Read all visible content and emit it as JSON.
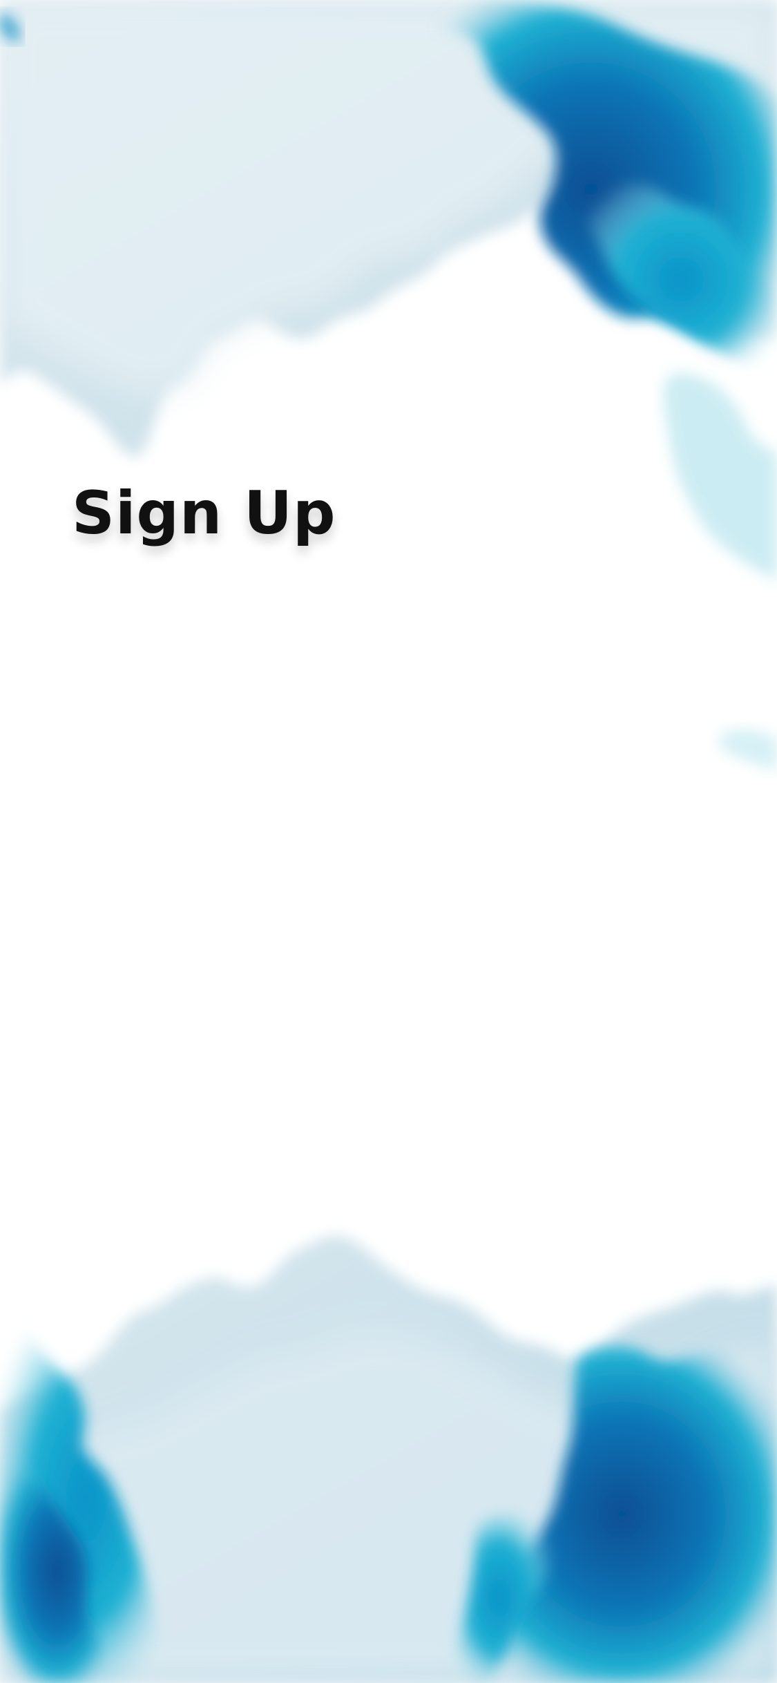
{
  "screen": {
    "title": "Sign Up"
  },
  "theme": {
    "background": "#ffffff",
    "ink_light": "#d9e8ef",
    "ink_mid": "#9fd0e3",
    "ink_cyan": "#1fb1d3",
    "ink_blue": "#0b73b4",
    "ink_deep": "#064f93",
    "text": "#111111"
  }
}
